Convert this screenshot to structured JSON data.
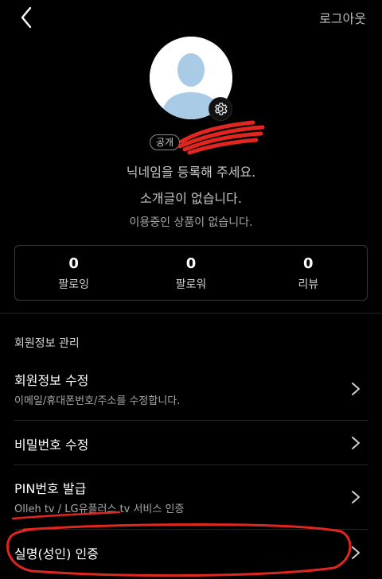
{
  "header": {
    "logout_label": "로그아웃"
  },
  "profile": {
    "public_badge": "공개",
    "nickname_prompt": "닉네임을 등록해 주세요.",
    "intro_text": "소개글이 없습니다.",
    "product_text": "이용중인 상품이 없습니다."
  },
  "stats": [
    {
      "value": "0",
      "label": "팔로잉"
    },
    {
      "value": "0",
      "label": "팔로워"
    },
    {
      "value": "0",
      "label": "리뷰"
    }
  ],
  "section": {
    "title": "회원정보 관리"
  },
  "menu": [
    {
      "title": "회원정보 수정",
      "subtitle": "이메일/휴대폰번호/주소를 수정합니다."
    },
    {
      "title": "비밀번호 수정"
    },
    {
      "title": "PIN번호 발급",
      "subtitle": "Olleh tv / LG유플러스 tv 서비스 인증"
    },
    {
      "title": "실명(성인) 인증"
    }
  ],
  "colors": {
    "background": "#000000",
    "annotation_red": "#e0261f"
  },
  "icons": [
    "back-arrow-icon",
    "gear-icon",
    "chevron-right-icon",
    "person-silhouette-icon"
  ]
}
